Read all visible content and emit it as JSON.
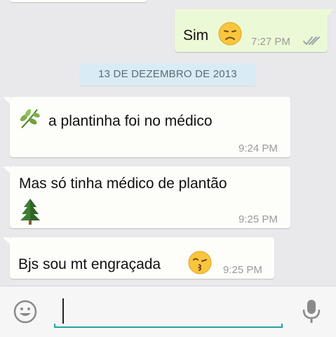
{
  "chat": {
    "date_separator": "13 DE DEZEMBRO DE 2013",
    "messages": [
      {
        "direction": "out",
        "text": "Sim",
        "emoji": "disappointed-face-icon",
        "time": "7:27 PM",
        "status": "read-double-check"
      },
      {
        "direction": "in",
        "text": "a plantinha foi no médico",
        "emoji": "herb-icon",
        "time": "9:24 PM"
      },
      {
        "direction": "in",
        "text": "Mas só tinha médico de plantão",
        "emoji": "evergreen-tree-icon",
        "time": "9:25 PM"
      },
      {
        "direction": "in",
        "text": "Bjs sou mt engraçada",
        "emoji": "kissing-face-icon",
        "time": "9:25 PM"
      }
    ]
  },
  "composer": {
    "value": "",
    "emoji_button": "smiley-icon",
    "mic_button": "microphone-icon"
  },
  "colors": {
    "background": "#e9e9ec",
    "incoming_bubble": "#fdfdfa",
    "outgoing_bubble": "#ecf9d6",
    "date_chip": "#d9ecf6",
    "input_underline": "#23a6a2"
  }
}
